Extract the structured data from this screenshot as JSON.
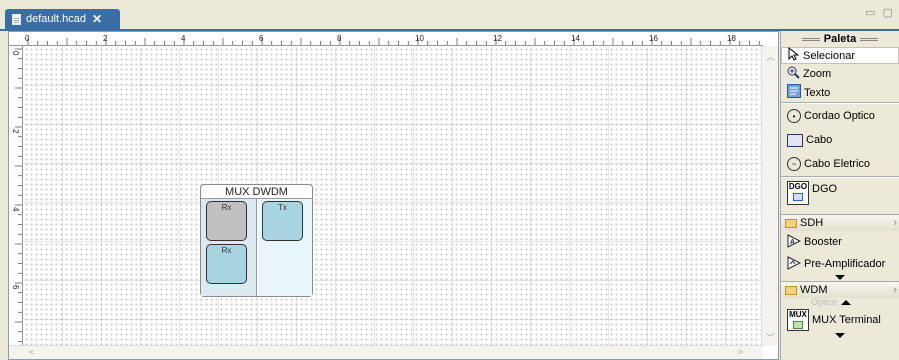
{
  "tab": {
    "title": "default.hcad",
    "close_glyph": "✕"
  },
  "window_controls": "▭ ▢",
  "ruler": {
    "h_labels": [
      "0",
      "2",
      "4",
      "6",
      "8",
      "10",
      "12",
      "14",
      "16",
      "18"
    ],
    "v_labels": [
      "0",
      "2",
      "4",
      "6"
    ]
  },
  "mux": {
    "title": "MUX DWDM",
    "ports": {
      "rx1": "Rx",
      "rx2": "Rx",
      "tx": "Tx"
    }
  },
  "palette": {
    "title": "Paleta",
    "items": {
      "selecionar": "Selecionar",
      "zoom": "Zoom",
      "texto": "Texto",
      "cordao_optico": "Cordao Optico",
      "cabo": "Cabo",
      "cabo_eletrico": "Cabo Eletrico",
      "dgo": "DGO",
      "dgo_icon_text": "DGO",
      "sdh": "SDH",
      "booster": "Booster",
      "pre_amplificador": "Pre-Amplificador",
      "wdm": "WDM",
      "optico_hint": "Optico",
      "mux_terminal": "MUX Terminal",
      "mux_icon_text": "MUX"
    }
  }
}
